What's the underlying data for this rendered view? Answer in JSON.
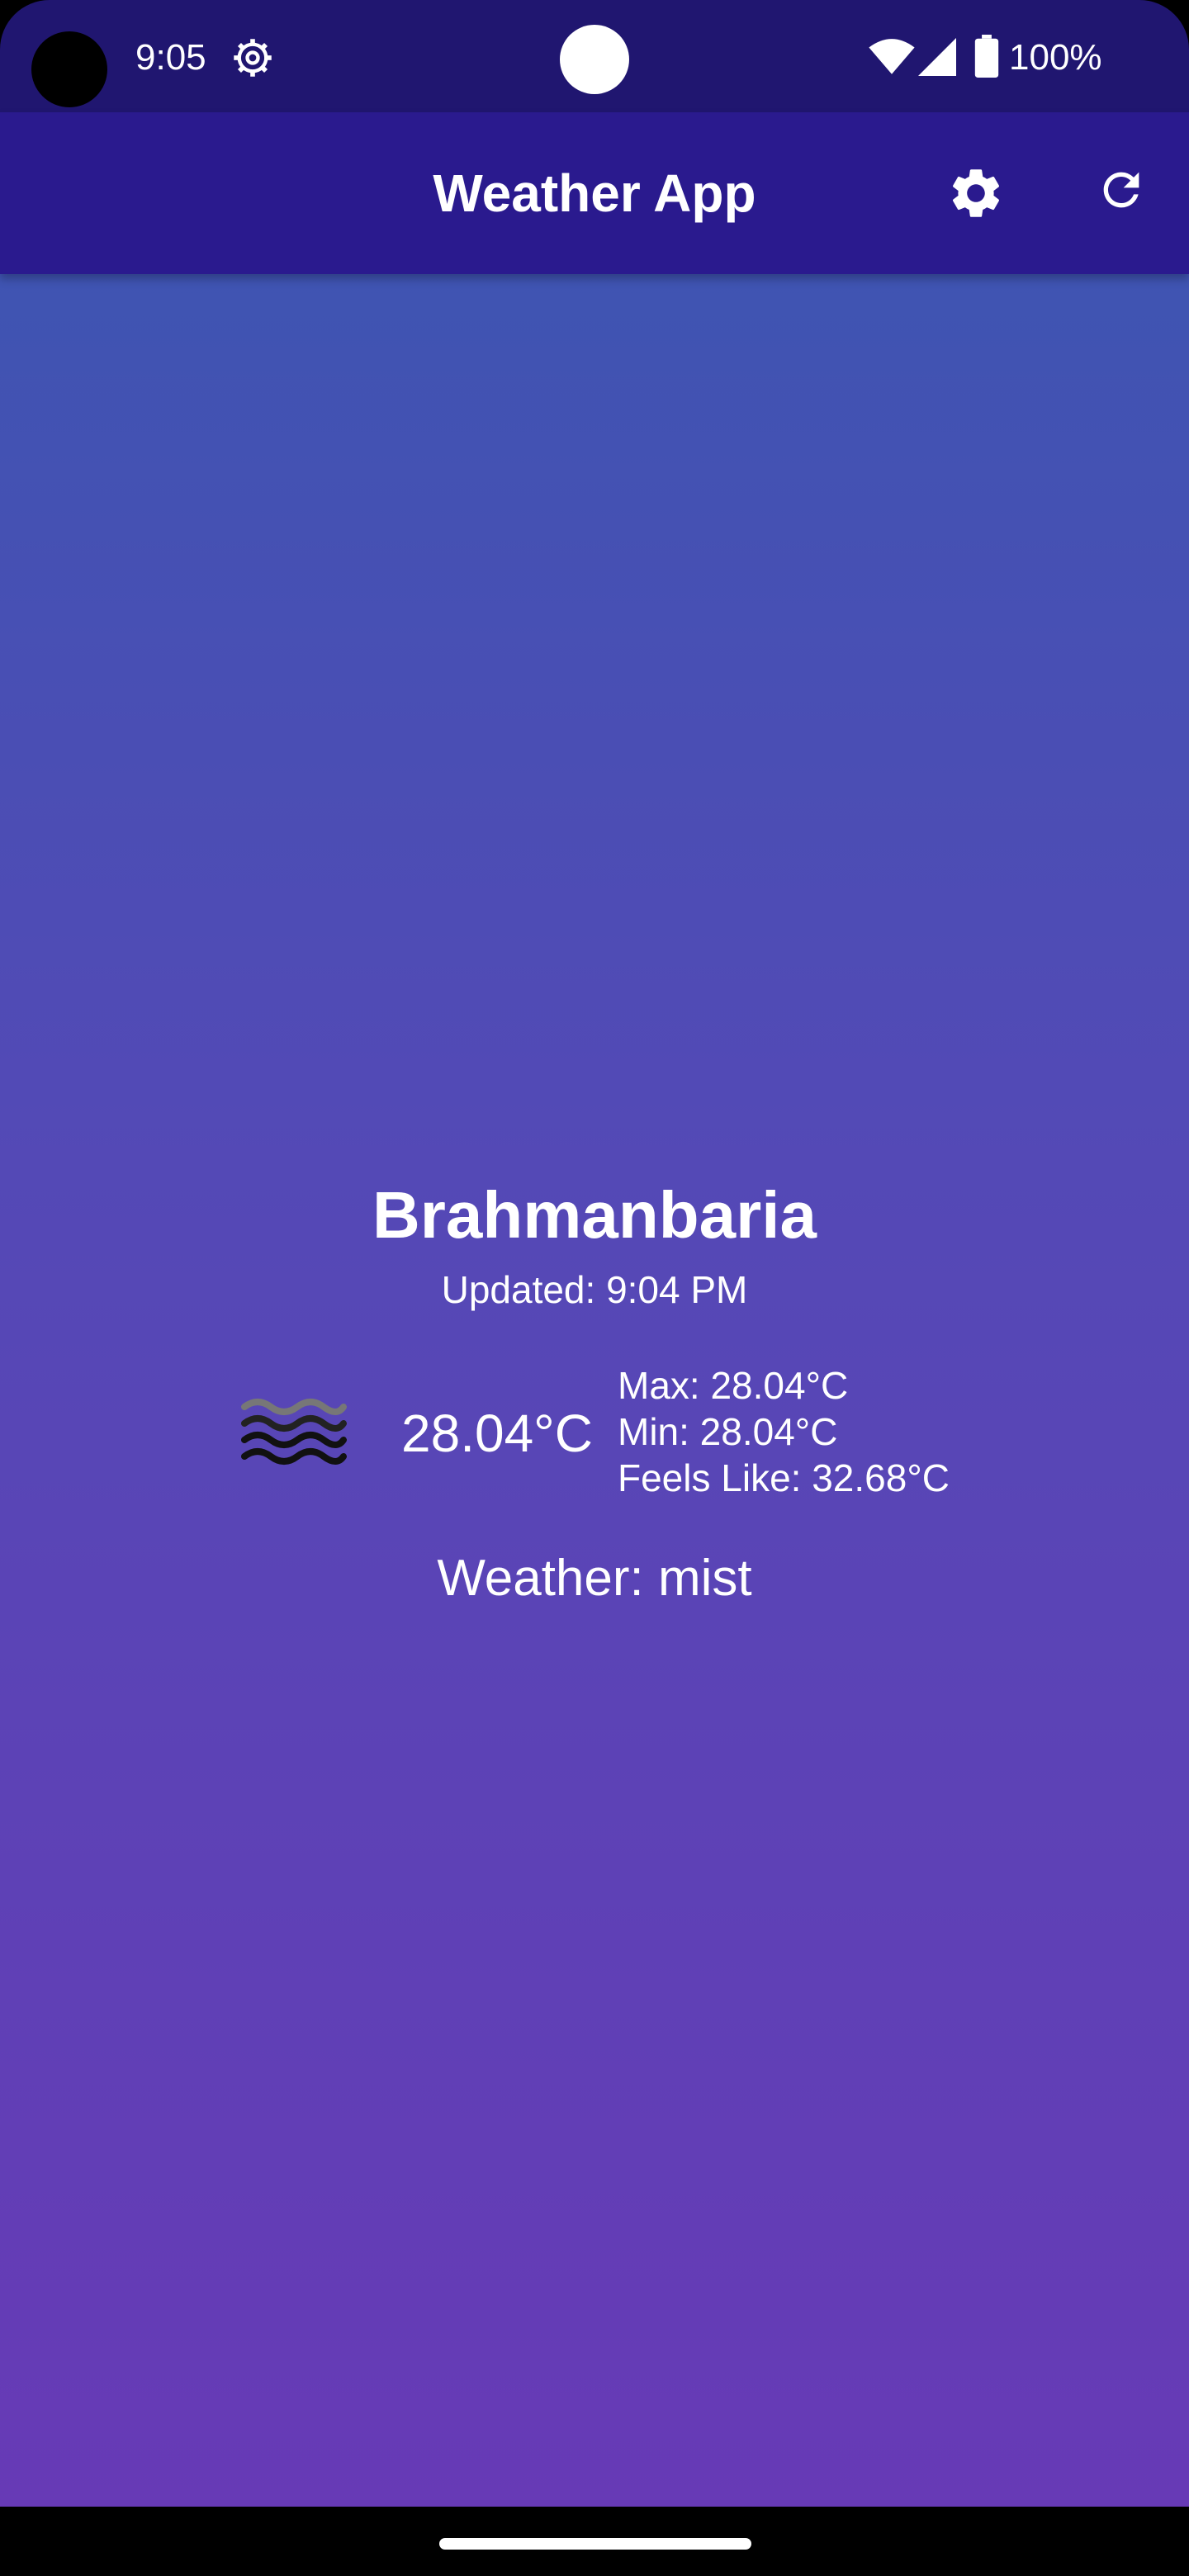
{
  "status_bar": {
    "time": "9:05",
    "battery": "100%"
  },
  "app_bar": {
    "title": "Weather App"
  },
  "weather": {
    "city": "Brahmanbaria",
    "updated": "Updated: 9:04 PM",
    "temperature": "28.04°C",
    "max": "Max: 28.04°C",
    "min": "Min: 28.04°C",
    "feels_like": "Feels Like: 32.68°C",
    "condition": "Weather: mist",
    "icon": "mist-icon"
  },
  "colors": {
    "status_bar": "#201670",
    "app_bar": "#2a1a8e",
    "gradient_top": "#3f54b2",
    "gradient_bottom": "#673ab6"
  }
}
